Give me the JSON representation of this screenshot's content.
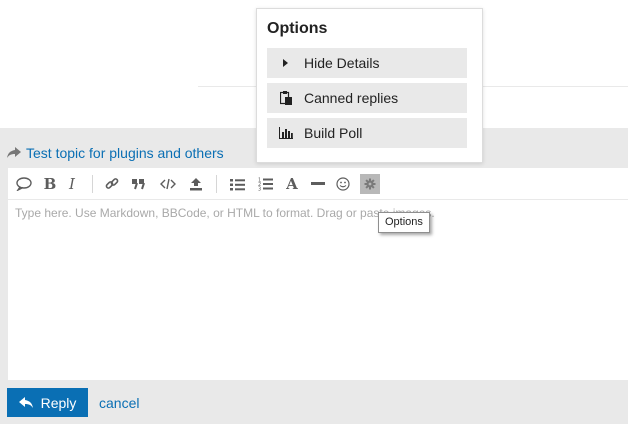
{
  "popup": {
    "title": "Options",
    "items": [
      {
        "label": "Hide Details",
        "icon": "caret-right-icon"
      },
      {
        "label": "Canned replies",
        "icon": "clipboard-icon"
      },
      {
        "label": "Build Poll",
        "icon": "bar-chart-icon"
      }
    ]
  },
  "composer": {
    "reply_to": "Test topic for plugins and others",
    "placeholder": "Type here. Use Markdown, BBCode, or HTML to format. Drag or paste images.",
    "tooltip": "Options",
    "reply_label": "Reply",
    "cancel_label": "cancel",
    "toolbar": {
      "bold": "B",
      "italic": "I",
      "heading": "A"
    }
  },
  "colors": {
    "accent": "#0a6fb4",
    "panel": "#e9e9e9",
    "toolbar_icon": "#5d5d5d"
  }
}
